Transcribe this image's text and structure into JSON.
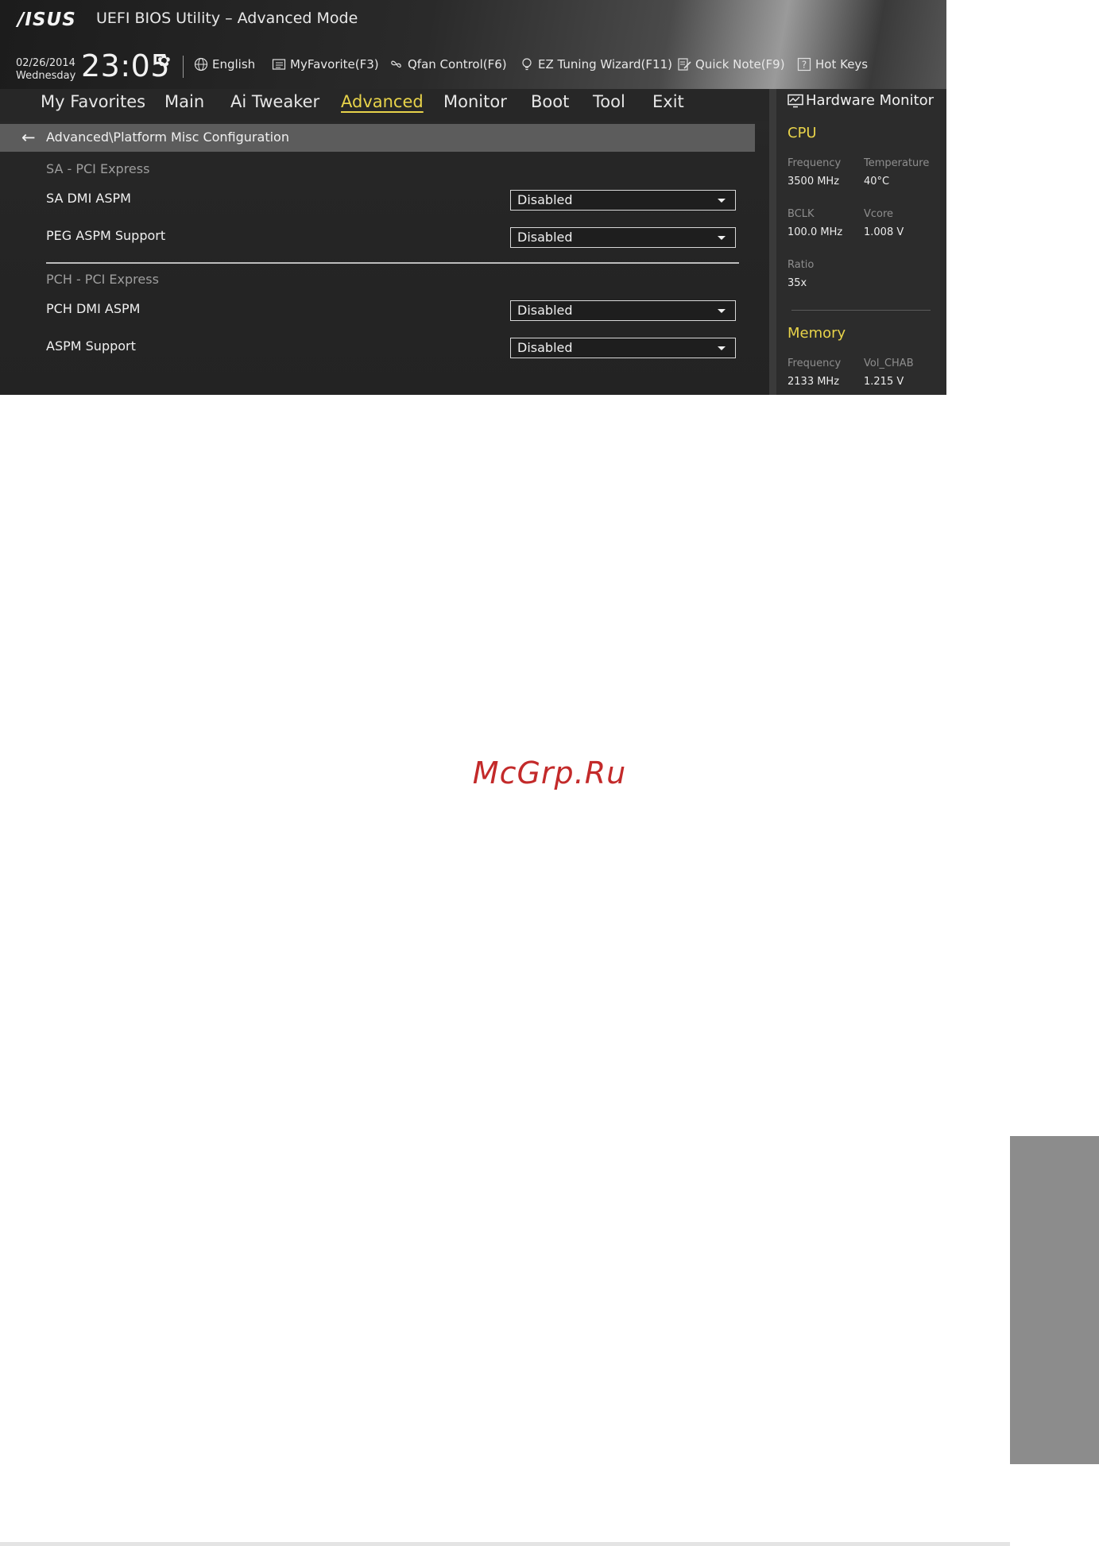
{
  "header": {
    "logo": "/ISUS",
    "title": "UEFI BIOS Utility – Advanced Mode",
    "date": "02/26/2014",
    "weekday": "Wednesday",
    "time": "23:05"
  },
  "toolbar": {
    "language": "English",
    "myfavorite": "MyFavorite(F3)",
    "qfan": "Qfan Control(F6)",
    "ez_tuning": "EZ Tuning Wizard(F11)",
    "quick_note": "Quick Note(F9)",
    "hot_keys": "Hot Keys"
  },
  "nav": {
    "items": [
      "My Favorites",
      "Main",
      "Ai Tweaker",
      "Advanced",
      "Monitor",
      "Boot",
      "Tool",
      "Exit"
    ],
    "active": "Advanced"
  },
  "breadcrumb": "Advanced\\Platform Misc Configuration",
  "settings": {
    "sa_section": "SA - PCI Express",
    "sa_dmi_aspm": {
      "label": "SA DMI ASPM",
      "value": "Disabled"
    },
    "peg_aspm": {
      "label": "PEG ASPM Support",
      "value": "Disabled"
    },
    "pch_section": "PCH - PCI Express",
    "pch_dmi_aspm": {
      "label": "PCH DMI ASPM",
      "value": "Disabled"
    },
    "aspm_support": {
      "label": "ASPM Support",
      "value": "Disabled"
    }
  },
  "hardware_monitor": {
    "title": "Hardware Monitor",
    "cpu": {
      "heading": "CPU",
      "frequency_label": "Frequency",
      "frequency": "3500 MHz",
      "temperature_label": "Temperature",
      "temperature": "40°C",
      "bclk_label": "BCLK",
      "bclk": "100.0 MHz",
      "vcore_label": "Vcore",
      "vcore": "1.008 V",
      "ratio_label": "Ratio",
      "ratio": "35x"
    },
    "memory": {
      "heading": "Memory",
      "frequency_label": "Frequency",
      "frequency": "2133 MHz",
      "volchab_label": "Vol_CHAB",
      "volchab": "1.215 V"
    }
  },
  "watermark": "McGrp.Ru",
  "colors": {
    "accent": "#e8d34a",
    "watermark": "#c32a2a",
    "side_tab": "#8c8c8c"
  }
}
